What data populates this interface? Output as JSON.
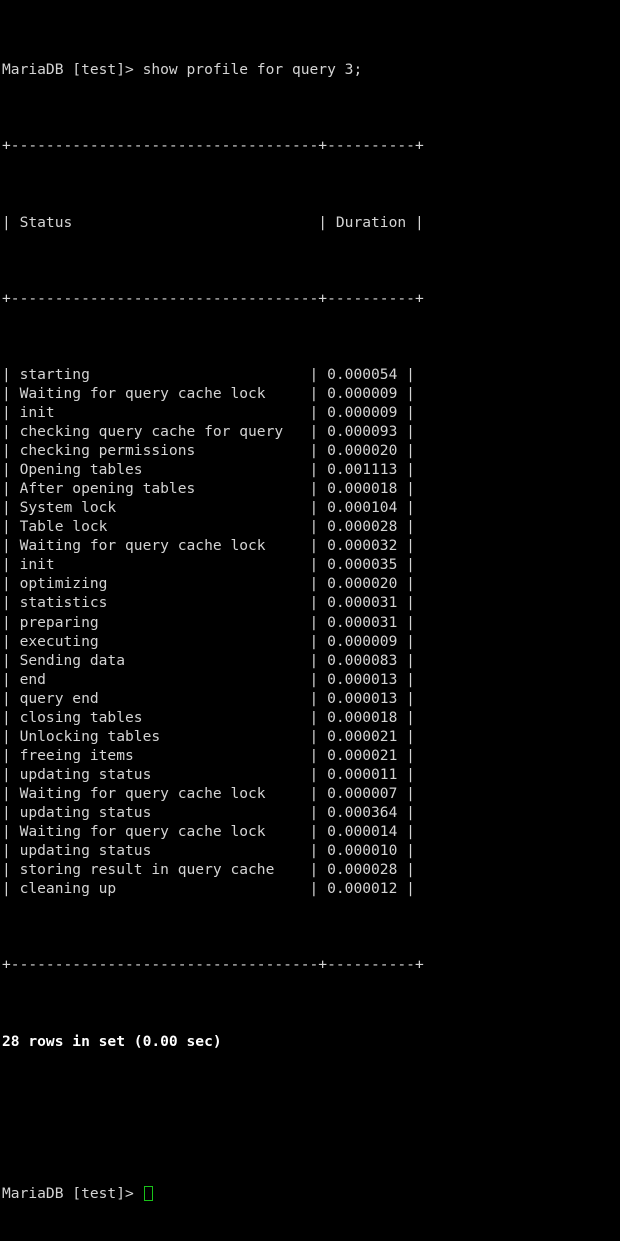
{
  "terminal": {
    "background_color": "#000000",
    "text_color": "#d4d4d4",
    "bright_text_color": "#ffffff",
    "cursor_color": "#19c219",
    "prompt": "MariaDB [test]> ",
    "command": "show profile for query 3;",
    "first_line": "MariaDB [test]> show profile for query 3;",
    "final_prompt": "MariaDB [test]> ",
    "result_summary": "28 rows in set (0.00 sec)",
    "separator": "+-----------------------------------+----------+",
    "header_line": "| Status                            | Duration |"
  },
  "table": {
    "columns": [
      "Status",
      "Duration"
    ],
    "status_width": 33,
    "duration_width": 8,
    "row_count": 28,
    "rows": [
      {
        "status": "starting",
        "duration": "0.000054"
      },
      {
        "status": "Waiting for query cache lock",
        "duration": "0.000009"
      },
      {
        "status": "init",
        "duration": "0.000009"
      },
      {
        "status": "checking query cache for query",
        "duration": "0.000093"
      },
      {
        "status": "checking permissions",
        "duration": "0.000020"
      },
      {
        "status": "Opening tables",
        "duration": "0.001113"
      },
      {
        "status": "After opening tables",
        "duration": "0.000018"
      },
      {
        "status": "System lock",
        "duration": "0.000104"
      },
      {
        "status": "Table lock",
        "duration": "0.000028"
      },
      {
        "status": "Waiting for query cache lock",
        "duration": "0.000032"
      },
      {
        "status": "init",
        "duration": "0.000035"
      },
      {
        "status": "optimizing",
        "duration": "0.000020"
      },
      {
        "status": "statistics",
        "duration": "0.000031"
      },
      {
        "status": "preparing",
        "duration": "0.000031"
      },
      {
        "status": "executing",
        "duration": "0.000009"
      },
      {
        "status": "Sending data",
        "duration": "0.000083"
      },
      {
        "status": "end",
        "duration": "0.000013"
      },
      {
        "status": "query end",
        "duration": "0.000013"
      },
      {
        "status": "closing tables",
        "duration": "0.000018"
      },
      {
        "status": "Unlocking tables",
        "duration": "0.000021"
      },
      {
        "status": "freeing items",
        "duration": "0.000021"
      },
      {
        "status": "updating status",
        "duration": "0.000011"
      },
      {
        "status": "Waiting for query cache lock",
        "duration": "0.000007"
      },
      {
        "status": "updating status",
        "duration": "0.000364"
      },
      {
        "status": "Waiting for query cache lock",
        "duration": "0.000014"
      },
      {
        "status": "updating status",
        "duration": "0.000010"
      },
      {
        "status": "storing result in query cache",
        "duration": "0.000028"
      },
      {
        "status": "cleaning up",
        "duration": "0.000012"
      }
    ]
  }
}
